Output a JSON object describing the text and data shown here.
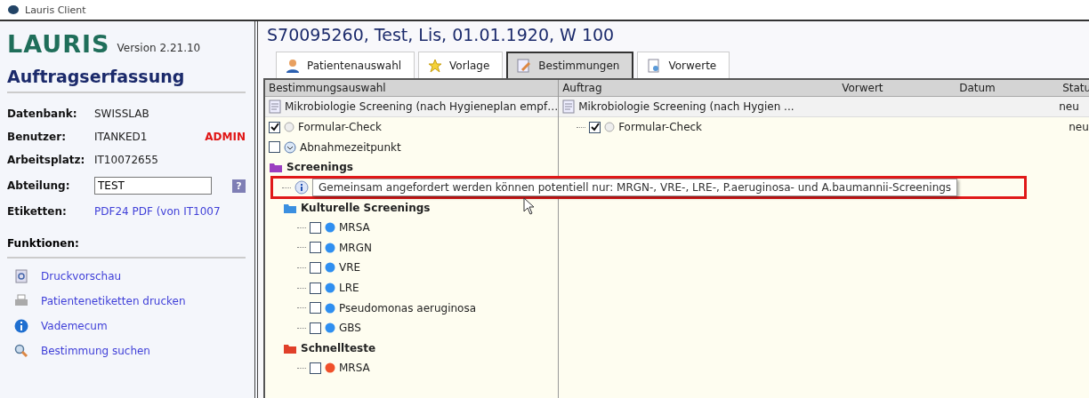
{
  "window": {
    "title": "Lauris Client"
  },
  "sidebar": {
    "logo": "LAURIS",
    "version": "Version 2.21.10",
    "heading": "Auftragserfassung",
    "fields": [
      {
        "label": "Datenbank:",
        "value": "SWISSLAB",
        "kind": "text"
      },
      {
        "label": "Benutzer:",
        "value": "ITANKED1",
        "badge": "ADMIN",
        "kind": "text"
      },
      {
        "label": "Arbeitsplatz:",
        "value": "IT10072655",
        "kind": "text"
      },
      {
        "label": "Abteilung:",
        "value": "TEST",
        "kind": "input",
        "help": "?"
      },
      {
        "label": "Etiketten:",
        "value": "PDF24 PDF (von IT1007",
        "kind": "link"
      }
    ],
    "functions_title": "Funktionen:",
    "functions": [
      {
        "label": "Druckvorschau",
        "kind": "preview"
      },
      {
        "label": "Patientenetiketten drucken",
        "kind": "printer"
      },
      {
        "label": "Vademecum",
        "kind": "info"
      },
      {
        "label": "Bestimmung suchen",
        "kind": "search"
      }
    ]
  },
  "patient_title": "S70095260, Test, Lis, 01.01.1920, W 100",
  "tabs": [
    {
      "label": "Patientenauswahl",
      "kind": "person",
      "selected": false
    },
    {
      "label": "Vorlage",
      "kind": "star",
      "selected": false
    },
    {
      "label": "Bestimmungen",
      "kind": "edit",
      "selected": true
    },
    {
      "label": "Vorwerte",
      "kind": "doc",
      "selected": false
    }
  ],
  "selection": {
    "header": "Bestimmungsauswahl",
    "template": "Mikrobiologie Screening (nach Hygieneplan empf…",
    "tree": [
      {
        "kind": "check",
        "label": "Formular-Check",
        "checked": true,
        "marker": {
          "kind": "radio"
        }
      },
      {
        "kind": "check",
        "label": "Abnahmezeitpunkt",
        "checked": false,
        "marker": {
          "kind": "clock"
        }
      },
      {
        "kind": "folder",
        "label": "Screenings",
        "color": "#9b3fc0",
        "children": [
          {
            "kind": "info",
            "label": "Gemeinsam angefordert werden können potentiell nur: MRGN-, VRE-, LRE-, P.aeruginosa- und A.baumannii-Screenings"
          },
          {
            "kind": "folder",
            "label": "Kulturelle Screenings",
            "color": "#3b8fe0",
            "children": [
              {
                "kind": "check",
                "label": "MRSA",
                "checked": false,
                "marker": {
                  "kind": "dot"
                },
                "color": "#2f8ff0"
              },
              {
                "kind": "check",
                "label": "MRGN",
                "checked": false,
                "marker": {
                  "kind": "dot"
                },
                "color": "#2f8ff0"
              },
              {
                "kind": "check",
                "label": "VRE",
                "checked": false,
                "marker": {
                  "kind": "dot"
                },
                "color": "#2f8ff0"
              },
              {
                "kind": "check",
                "label": "LRE",
                "checked": false,
                "marker": {
                  "kind": "dot"
                },
                "color": "#2f8ff0"
              },
              {
                "kind": "check",
                "label": "Pseudomonas aeruginosa",
                "checked": false,
                "marker": {
                  "kind": "dot"
                },
                "color": "#2f8ff0"
              },
              {
                "kind": "check",
                "label": "GBS",
                "checked": false,
                "marker": {
                  "kind": "dot"
                },
                "color": "#2f8ff0"
              }
            ]
          },
          {
            "kind": "folder",
            "label": "Schnellteste",
            "color": "#e0402a",
            "children": [
              {
                "kind": "check",
                "label": "MRSA",
                "checked": false,
                "marker": {
                  "kind": "dot"
                },
                "color": "#f0502a"
              }
            ]
          }
        ]
      }
    ]
  },
  "order": {
    "columns": [
      "Auftrag",
      "Vorwert",
      "Datum",
      "Statu"
    ],
    "rows": [
      {
        "kind": "template",
        "label": "Mikrobiologie Screening (nach Hygien ...",
        "status": "neu"
      },
      {
        "kind": "check",
        "label": "Formular-Check",
        "checked": true,
        "status": "neu"
      }
    ]
  }
}
